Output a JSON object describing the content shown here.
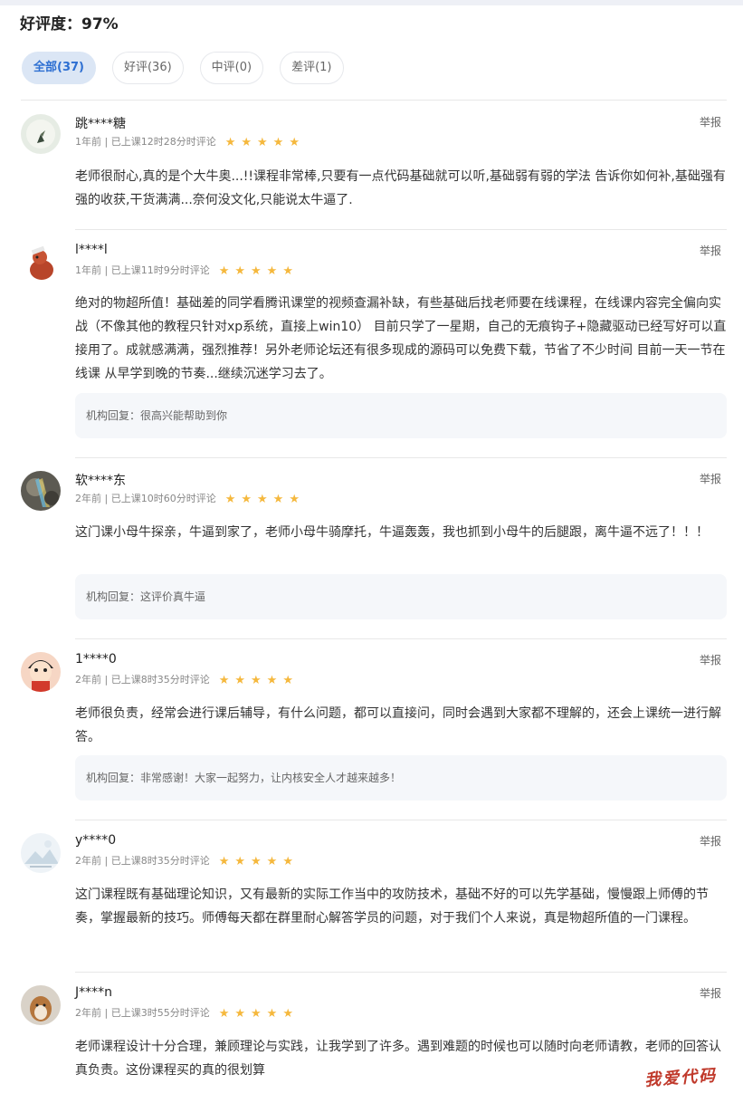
{
  "rating": {
    "label": "好评度：",
    "value": "97%"
  },
  "tabs": [
    {
      "label": "全部(37)"
    },
    {
      "label": "好评(36)"
    },
    {
      "label": "中评(0)"
    },
    {
      "label": "差评(1)"
    }
  ],
  "reviews": [
    {
      "username": "跳****糖",
      "meta": "1年前 | 已上课12时28分时评论",
      "stars": "★★★★★",
      "report": "举报",
      "content": "老师很耐心,真的是个大牛奥...!!课程非常棒,只要有一点代码基础就可以听,基础弱有弱的学法 告诉你如何补,基础强有强的收获,干货满满...奈何没文化,只能说太牛逼了."
    },
    {
      "username": "l****l",
      "meta": "1年前 | 已上课11时9分时评论",
      "stars": "★★★★★",
      "report": "举报",
      "content": "绝对的物超所值！基础差的同学看腾讯课堂的视频查漏补缺，有些基础后找老师要在线课程，在线课内容完全偏向实战（不像其他的教程只针对xp系统，直接上win10） 目前只学了一星期，自己的无痕钩子+隐藏驱动已经写好可以直接用了。成就感满满，强烈推荐！另外老师论坛还有很多现成的源码可以免费下载，节省了不少时间 目前一天一节在线课 从早学到晚的节奏...继续沉迷学习去了。",
      "reply": "机构回复：很高兴能帮助到你"
    },
    {
      "username": "软****东",
      "meta": "2年前 | 已上课10时60分时评论",
      "stars": "★★★★★",
      "report": "举报",
      "content": "这门课小母牛探亲，牛逼到家了，老师小母牛骑摩托，牛逼轰轰，我也抓到小母牛的后腿跟，离牛逼不远了！！！",
      "reply": "机构回复：这评价真牛逼"
    },
    {
      "username": "1****0",
      "meta": "2年前 | 已上课8时35分时评论",
      "stars": "★★★★★",
      "report": "举报",
      "content": "老师很负责，经常会进行课后辅导，有什么问题，都可以直接问，同时会遇到大家都不理解的，还会上课统一进行解答。",
      "reply": "机构回复：非常感谢！大家一起努力，让内核安全人才越来越多！"
    },
    {
      "username": "y****0",
      "meta": "2年前 | 已上课8时35分时评论",
      "stars": "★★★★★",
      "report": "举报",
      "content": "这门课程既有基础理论知识，又有最新的实际工作当中的攻防技术，基础不好的可以先学基础，慢慢跟上师傅的节奏，掌握最新的技巧。师傅每天都在群里耐心解答学员的问题，对于我们个人来说，真是物超所值的一门课程。"
    },
    {
      "username": "J****n",
      "meta": "2年前 | 已上课3时55分时评论",
      "stars": "★★★★★",
      "report": "举报",
      "content": "老师课程设计十分合理，兼顾理论与实践，让我学到了许多。遇到难题的时候也可以随时向老师请教，老师的回答认真负责。这份课程买的真的很划算"
    }
  ],
  "watermark": "我爱代码"
}
